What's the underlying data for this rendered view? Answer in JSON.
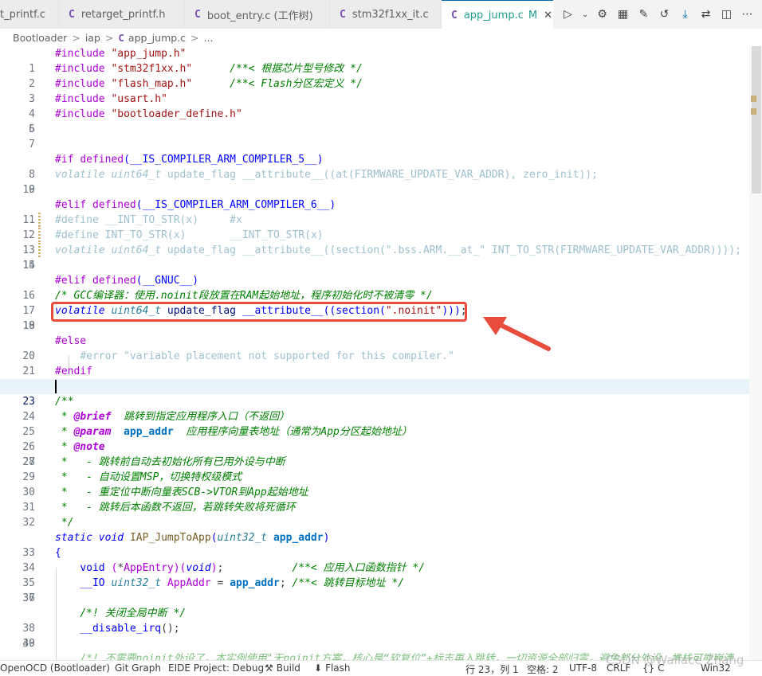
{
  "tabs": [
    {
      "label": "t_printf.c",
      "icon": "c-file-icon",
      "active": false
    },
    {
      "label": "retarget_printf.h",
      "icon": "c-file-icon",
      "active": false
    },
    {
      "label": "boot_entry.c (工作树)",
      "icon": "c-file-icon",
      "active": false
    },
    {
      "label": "stm32f1xx_it.c",
      "icon": "c-file-icon",
      "active": false
    },
    {
      "label": "app_jump.c",
      "icon": "c-file-icon",
      "active": true,
      "status": "M"
    }
  ],
  "tab_letter": "C",
  "tab_actions": [
    "run-debug-icon",
    "chevron-down-icon",
    "gear-icon",
    "build-icon",
    "clean-icon",
    "history-icon",
    "download-icon",
    "compare-icon",
    "split-editor-icon",
    "more-icon"
  ],
  "breadcrumb": {
    "items": [
      "Bootloader",
      "iap",
      "app_jump.c",
      "..."
    ],
    "sep": ">"
  },
  "editor": {
    "current_line": 23,
    "lines": [
      {
        "n": "1"
      },
      {
        "n": "2"
      },
      {
        "n": "3"
      },
      {
        "n": "4"
      },
      {
        "n": "5"
      },
      {
        "n": "6"
      },
      {
        "n": "7"
      },
      {
        "n": "8"
      },
      {
        "n": "9"
      },
      {
        "n": "10"
      },
      {
        "n": "11"
      },
      {
        "n": "12"
      },
      {
        "n": "13"
      },
      {
        "n": "14"
      },
      {
        "n": "15"
      },
      {
        "n": "16"
      },
      {
        "n": "17"
      },
      {
        "n": "18"
      },
      {
        "n": "19"
      },
      {
        "n": "20"
      },
      {
        "n": "21"
      },
      {
        "n": "22"
      },
      {
        "n": "23"
      },
      {
        "n": "24"
      },
      {
        "n": "25"
      },
      {
        "n": "26"
      },
      {
        "n": "27"
      },
      {
        "n": "28"
      },
      {
        "n": "29"
      },
      {
        "n": "30"
      },
      {
        "n": "31"
      },
      {
        "n": "32"
      },
      {
        "n": "33"
      },
      {
        "n": "34"
      },
      {
        "n": "35"
      },
      {
        "n": "36"
      },
      {
        "n": "37"
      },
      {
        "n": "38"
      },
      {
        "n": "39"
      },
      {
        "n": "40"
      },
      {
        "n": "41"
      }
    ],
    "t": {
      "inc": "#include",
      "s1": "\"app_jump.h\"",
      "s2": "\"stm32f1xx.h\"",
      "c2": "/**< 根据芯片型号修改 */",
      "s3": "\"flash_map.h\"",
      "c3": "/**< Flash分区宏定义 */",
      "s4": "\"usart.h\"",
      "s5": "\"bootloader_define.h\"",
      "if": "#if",
      "defined": "defined",
      "m5": "__IS_COMPILER_ARM_COMPILER_5__",
      "volatile": "volatile",
      "u64": "uint64_t",
      "uflag": "update_flag",
      "attr": "__attribute__",
      "at": "at",
      "fuva": "FIRMWARE_UPDATE_VAR_ADDR",
      "zi": "zero_init",
      "elif": "#elif",
      "m6": "__IS_COMPILER_ARM_COMPILER_6__",
      "define": "#define",
      "its2": "__INT_TO_STR",
      "its": "INT_TO_STR",
      "x": "x",
      "hx": "#x",
      "section": "section",
      "s14": "\".bss.ARM.__at_\"",
      "gnuc": "__GNUC__",
      "c17": "/* GCC编译器：使用.noinit段放置在RAM起始地址，程序初始化时不被清零 */",
      "s18": "\".noinit\"",
      "else": "#else",
      "error": "#error",
      "s21": "\"variable placement not supported for this compiler.\"",
      "endif": "#endif",
      "c24": "/**",
      "star": " * ",
      "brief": "@brief",
      "c25": "  跳转到指定应用程序入口（不返回）",
      "param": "@param",
      "paddr": "app_addr",
      "c26": "  应用程序向量表地址（通常为App分区起始地址）",
      "note": "@note",
      "c28": " *   - 跳转前自动去初始化所有已用外设与中断",
      "c29": " *   - 自动设置MSP，切换特权级模式",
      "c30": " *   - 重定位中断向量表SCB->VTOR到App起始地址",
      "c31": " *   - 跳转后本函数不返回，若跳转失败将死循环",
      "c32": " */",
      "static": "static",
      "void": "void",
      "iapfn": "IAP_JumpToApp",
      "u32": "uint32_t",
      "appaddr": "app_addr",
      "lbrace": "{",
      "appentry": "AppEntry",
      "c35": "/**< 应用入口函数指针 */",
      "io": "__IO",
      "appaddrv": "AppAddr",
      "c36": "/**< 跳转目标地址 */",
      "c38": "/*! 关闭全局中断 */",
      "dirq": "__disable_irq",
      "c41": "/*! 不需要noinit外设了，本实例使用\"无noinit方案，核心是“软复位”+标志再入跳转，一切资源全部归零，避免部分外设、堆栈可能崩溃"
    }
  },
  "statusbar": {
    "openocd": "OpenOCD (Bootloader)",
    "git": "Git Graph",
    "eide": "EIDE Project: Debug",
    "build": "Build",
    "flash": "Flash",
    "position": "行 23，列 1",
    "spaces": "空格: 2",
    "encoding": "UTF-8",
    "eol": "CRLF",
    "lang": "{} C",
    "platform": "Win32"
  },
  "watermark": "CSDN @Wallace Zhang",
  "colors": {
    "accent": "#0066b8",
    "highlight_box": "#e74c3c",
    "arrow": "#e74c3c",
    "modified": "#1f9e8f"
  }
}
